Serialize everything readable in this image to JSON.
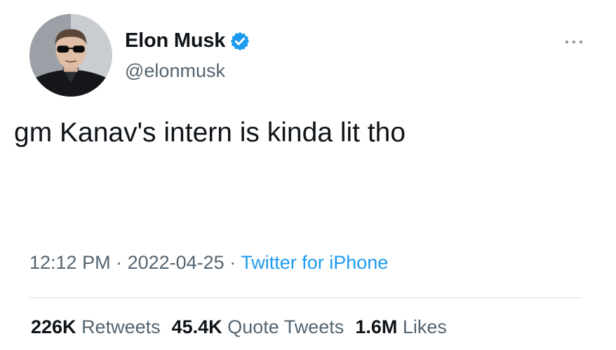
{
  "author": {
    "display_name": "Elon Musk",
    "handle": "@elonmusk",
    "verified": true,
    "avatar_icon": "profile-photo-man-sunglasses"
  },
  "tweet": {
    "text": "gm Kanav's intern is kinda lit tho"
  },
  "meta": {
    "time": "12:12 PM",
    "separator": " · ",
    "date": "2022-04-25",
    "source": "Twitter for iPhone"
  },
  "stats": {
    "retweets": {
      "count": "226K",
      "label": "Retweets"
    },
    "quotes": {
      "count": "45.4K",
      "label": "Quote Tweets"
    },
    "likes": {
      "count": "1.6M",
      "label": "Likes"
    }
  },
  "icons": {
    "verified": "verified-badge-icon",
    "more": "more-options-icon"
  },
  "colors": {
    "accent": "#1d9bf0",
    "text": "#0f1419",
    "secondary_text": "#536471",
    "divider": "#d6dbdf"
  }
}
